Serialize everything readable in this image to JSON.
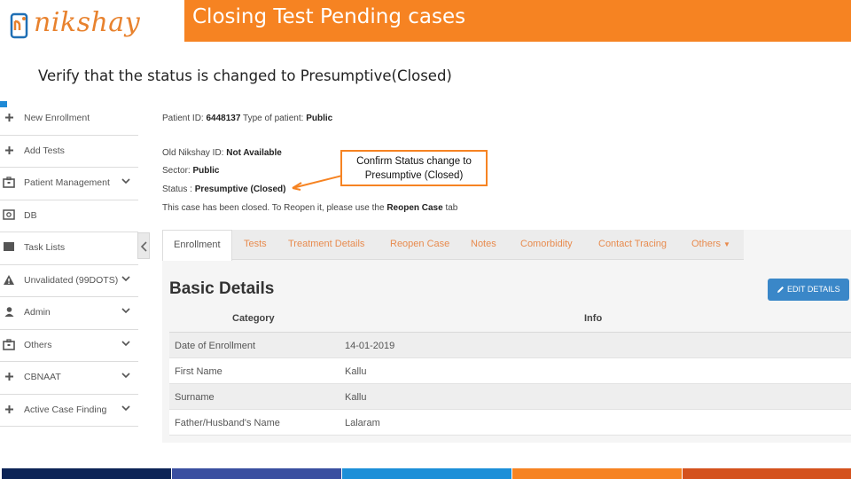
{
  "brand": {
    "name": "nikshay"
  },
  "slide": {
    "title": "Closing Test Pending cases",
    "subtitle": "Verify that the status is changed to Presumptive(Closed)"
  },
  "sidebar": {
    "items": [
      {
        "label": "New Enrollment",
        "icon": "plus-icon",
        "has_chevron": false
      },
      {
        "label": "Add Tests",
        "icon": "plus-icon",
        "has_chevron": false
      },
      {
        "label": "Patient Management",
        "icon": "briefcase-icon",
        "has_chevron": true
      },
      {
        "label": "DB",
        "icon": "dashboard-icon",
        "has_chevron": false
      },
      {
        "label": "Task Lists",
        "icon": "list-icon",
        "has_chevron": false
      },
      {
        "label": "Unvalidated (99DOTS)",
        "icon": "warning-icon",
        "has_chevron": true
      },
      {
        "label": "Admin",
        "icon": "user-icon",
        "has_chevron": true
      },
      {
        "label": "Others",
        "icon": "briefcase-icon",
        "has_chevron": true
      },
      {
        "label": "CBNAAT",
        "icon": "plus-icon",
        "has_chevron": true
      },
      {
        "label": "Active Case Finding",
        "icon": "plus-icon",
        "has_chevron": true
      }
    ]
  },
  "patient": {
    "id_label": "Patient ID:",
    "id_value": "6448137",
    "type_label": "Type of patient:",
    "type_value": "Public",
    "old_id_label": "Old Nikshay ID:",
    "old_id_value": "Not Available",
    "sector_label": "Sector:",
    "sector_value": "Public",
    "status_label": "Status :",
    "status_value": "Presumptive (Closed)",
    "closed_msg_pre": "This case has been closed. To Reopen it, please use the",
    "closed_msg_bold": "Reopen Case",
    "closed_msg_post": "tab"
  },
  "callout": {
    "line1": "Confirm Status change to",
    "line2": "Presumptive (Closed)"
  },
  "tabs": [
    {
      "label": "Enrollment",
      "active": true
    },
    {
      "label": "Tests",
      "active": false
    },
    {
      "label": "Treatment Details",
      "active": false
    },
    {
      "label": "Reopen Case",
      "active": false
    },
    {
      "label": "Notes",
      "active": false
    },
    {
      "label": "Comorbidity",
      "active": false
    },
    {
      "label": "Contact Tracing",
      "active": false
    },
    {
      "label": "Others",
      "active": false
    }
  ],
  "details": {
    "title": "Basic Details",
    "edit_label": "EDIT DETAILS",
    "col_category": "Category",
    "col_info": "Info",
    "rows": [
      {
        "category": "Date of Enrollment",
        "info": "14-01-2019"
      },
      {
        "category": "First Name",
        "info": "Kallu"
      },
      {
        "category": "Surname",
        "info": "Kallu"
      },
      {
        "category": "Father/Husband's Name",
        "info": "Lalaram"
      }
    ]
  },
  "colors": {
    "accent_orange": "#f68322",
    "link_orange": "#e88b4e",
    "button_blue": "#3a87c8",
    "band": [
      "#0c2456",
      "#3a4fa0",
      "#1c8fd8",
      "#f68322",
      "#d4521e"
    ]
  }
}
